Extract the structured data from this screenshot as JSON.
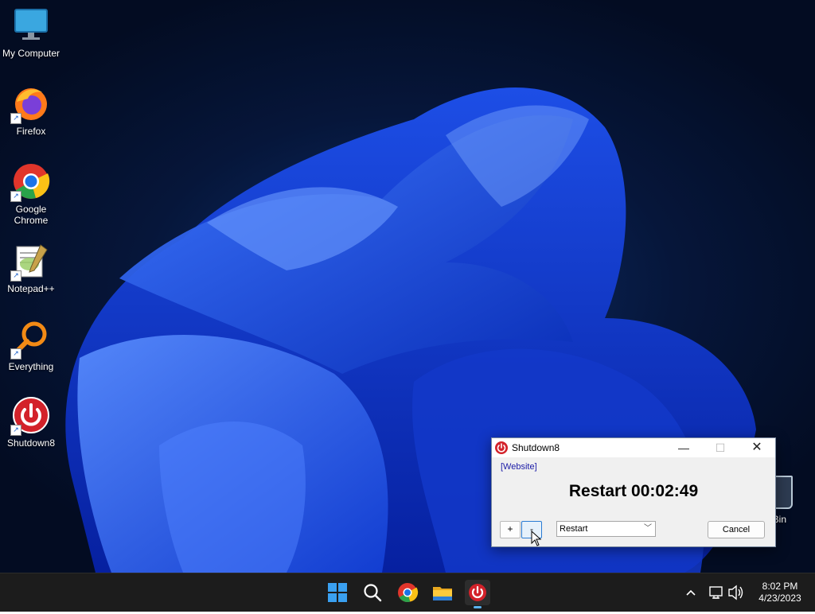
{
  "desktop": {
    "icons": [
      {
        "label": "My Computer",
        "icon": "monitor-icon"
      },
      {
        "label": "Firefox",
        "icon": "firefox-icon"
      },
      {
        "label": "Google Chrome",
        "icon": "chrome-icon"
      },
      {
        "label": "Notepad++",
        "icon": "notepadpp-icon"
      },
      {
        "label": "Everything",
        "icon": "everything-icon"
      },
      {
        "label": "Shutdown8",
        "icon": "shutdown8-icon"
      }
    ],
    "recycle_bin_label": "cle Bin"
  },
  "window": {
    "title": "Shutdown8",
    "website_link": "[Website]",
    "status_text": "Restart 00:02:49",
    "plus_label": "+",
    "minus_label": "-",
    "action_selected": "Restart",
    "cancel_label": "Cancel"
  },
  "taskbar": {
    "apps": [
      "start-icon",
      "search-icon",
      "chrome-icon",
      "file-explorer-icon",
      "shutdown8-icon"
    ],
    "active_app": "shutdown8-icon",
    "clock": {
      "time": "8:02 PM",
      "date": "4/23/2023"
    }
  },
  "colors": {
    "accent": "#5ab3f0",
    "shutdown_red": "#d3222a",
    "link": "#1a1aa6"
  }
}
